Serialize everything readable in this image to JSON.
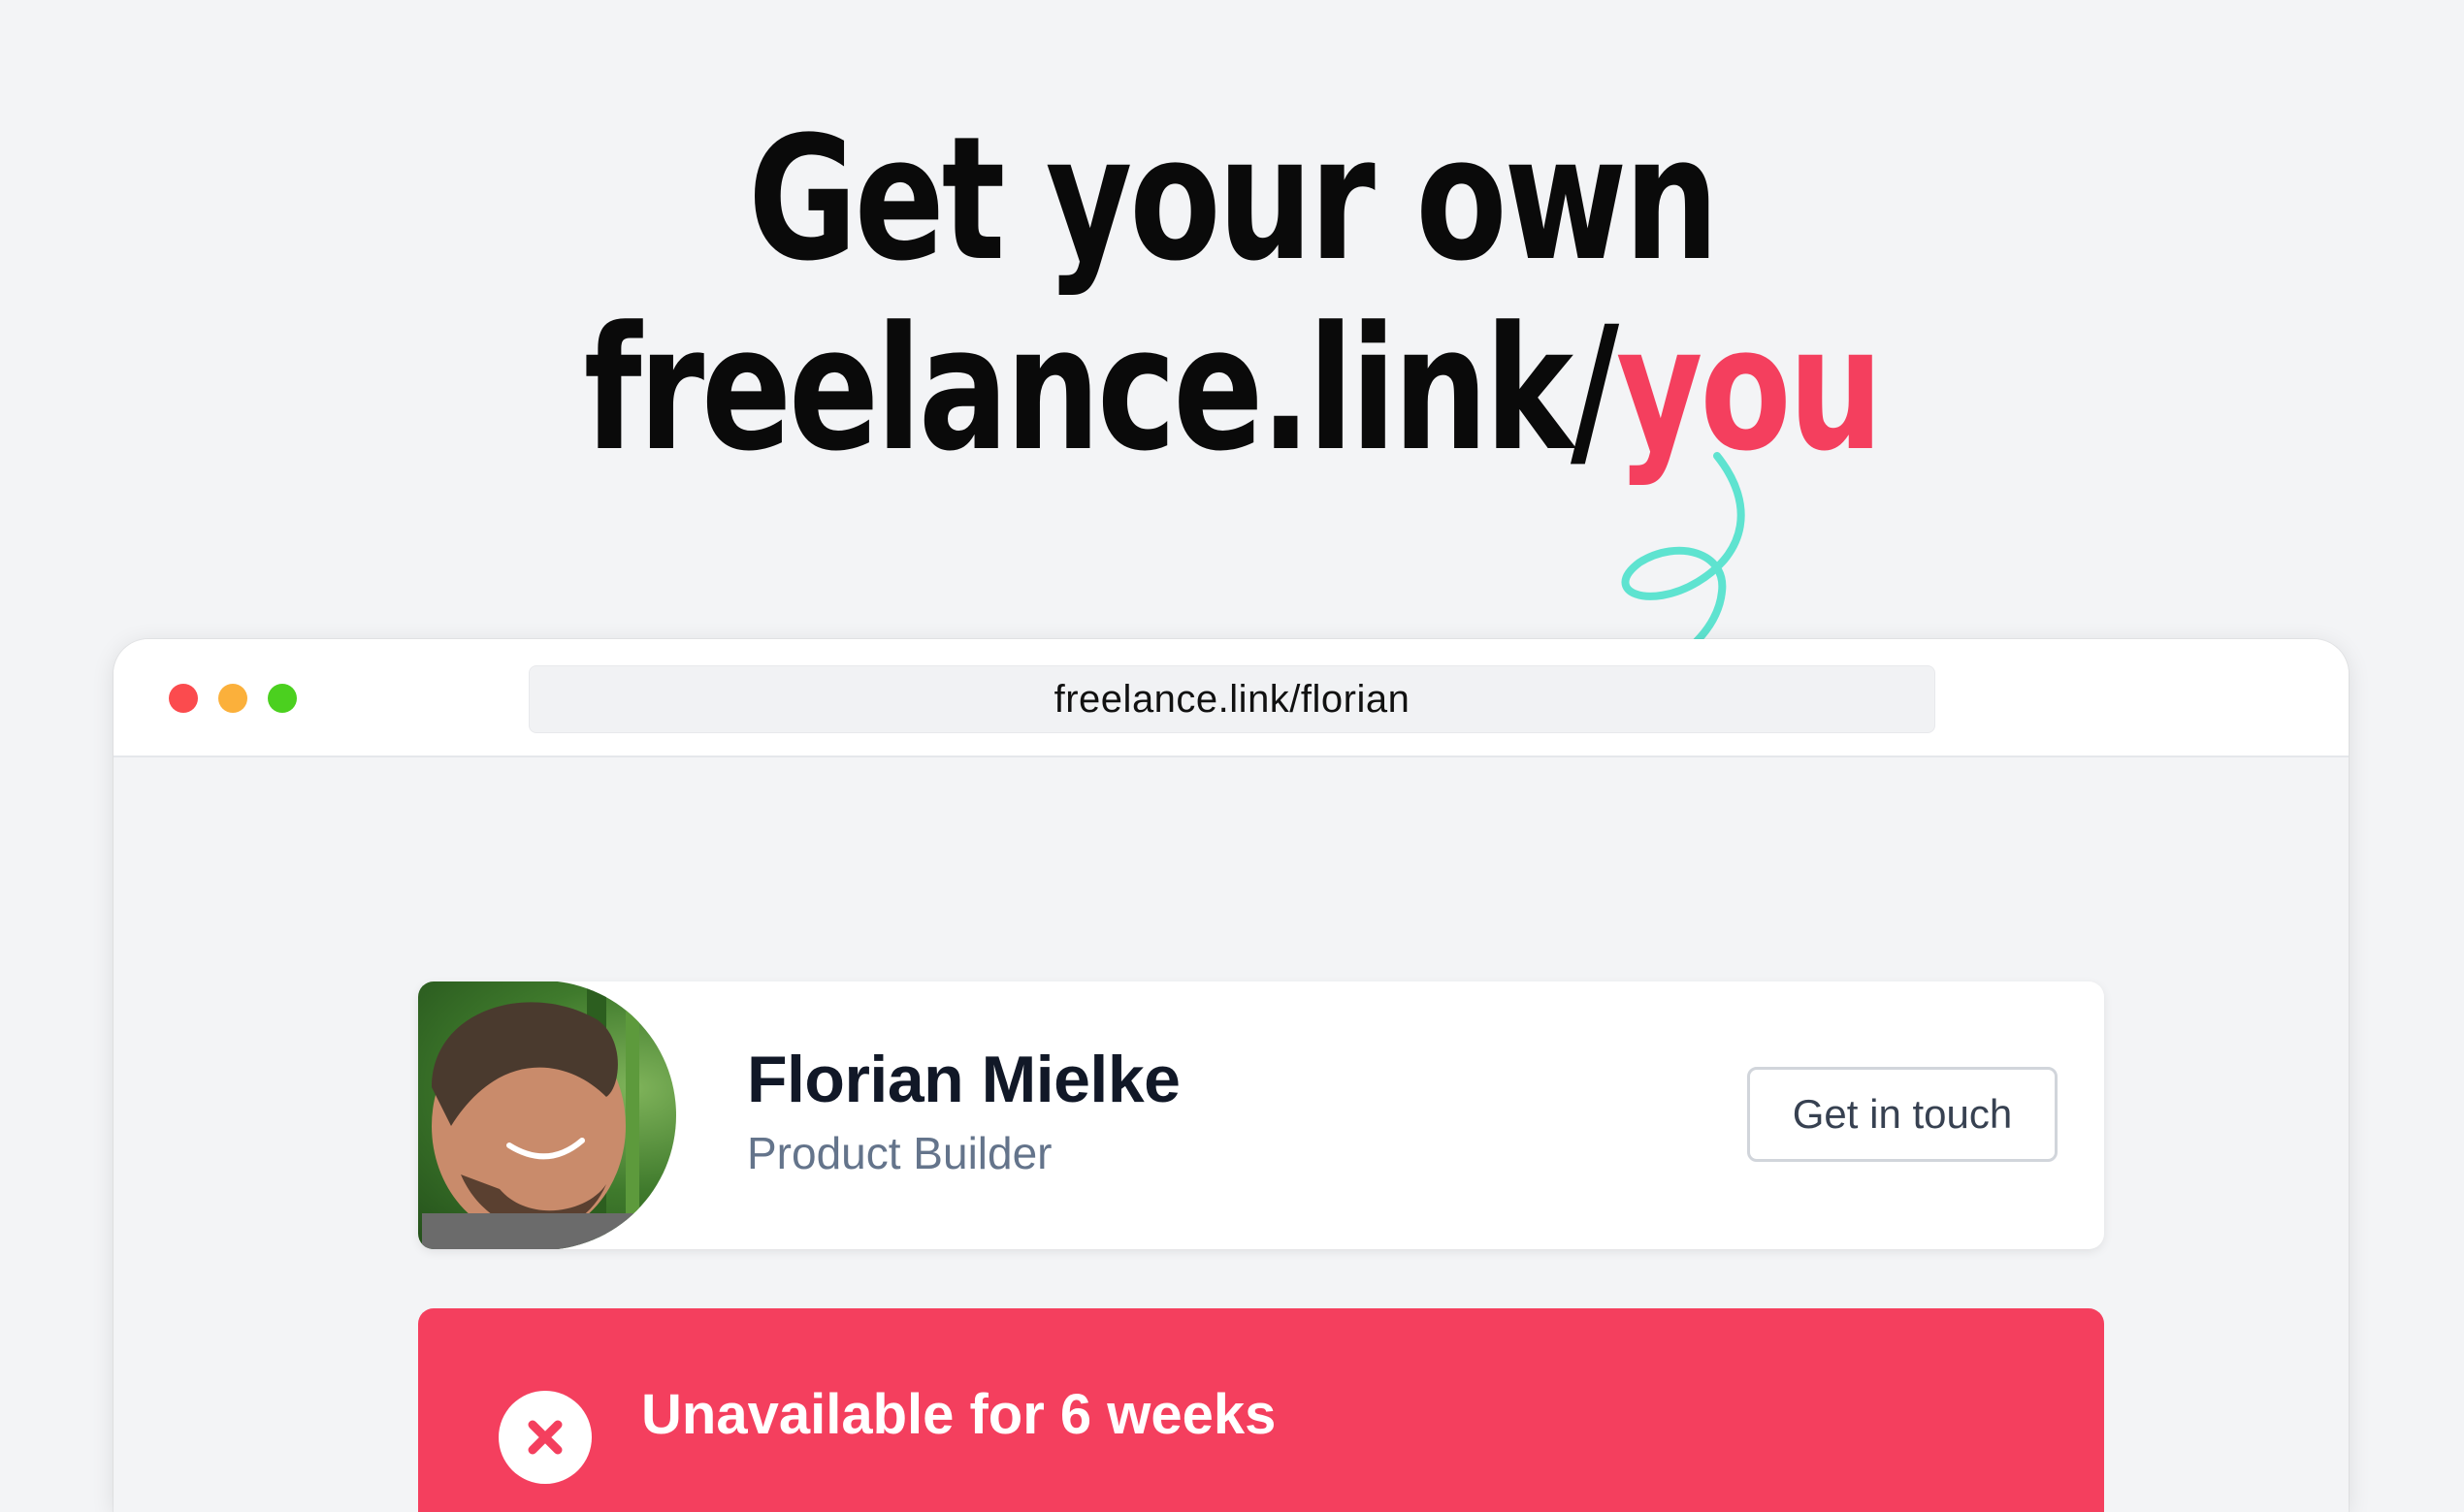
{
  "headline": {
    "line1": "Get your own",
    "line2_prefix": "freelance.link/",
    "line2_accent": "you"
  },
  "browser": {
    "url": "freelance.link/florian"
  },
  "profile": {
    "name": "Florian Mielke",
    "role": "Product Builder",
    "contact_label": "Get in touch"
  },
  "status": {
    "text": "Unavailable for 6 weeks",
    "icon": "x-close-icon"
  },
  "colors": {
    "accent": "#f43f5e",
    "squiggle": "#5ee3d0",
    "background": "#f3f4f6"
  }
}
